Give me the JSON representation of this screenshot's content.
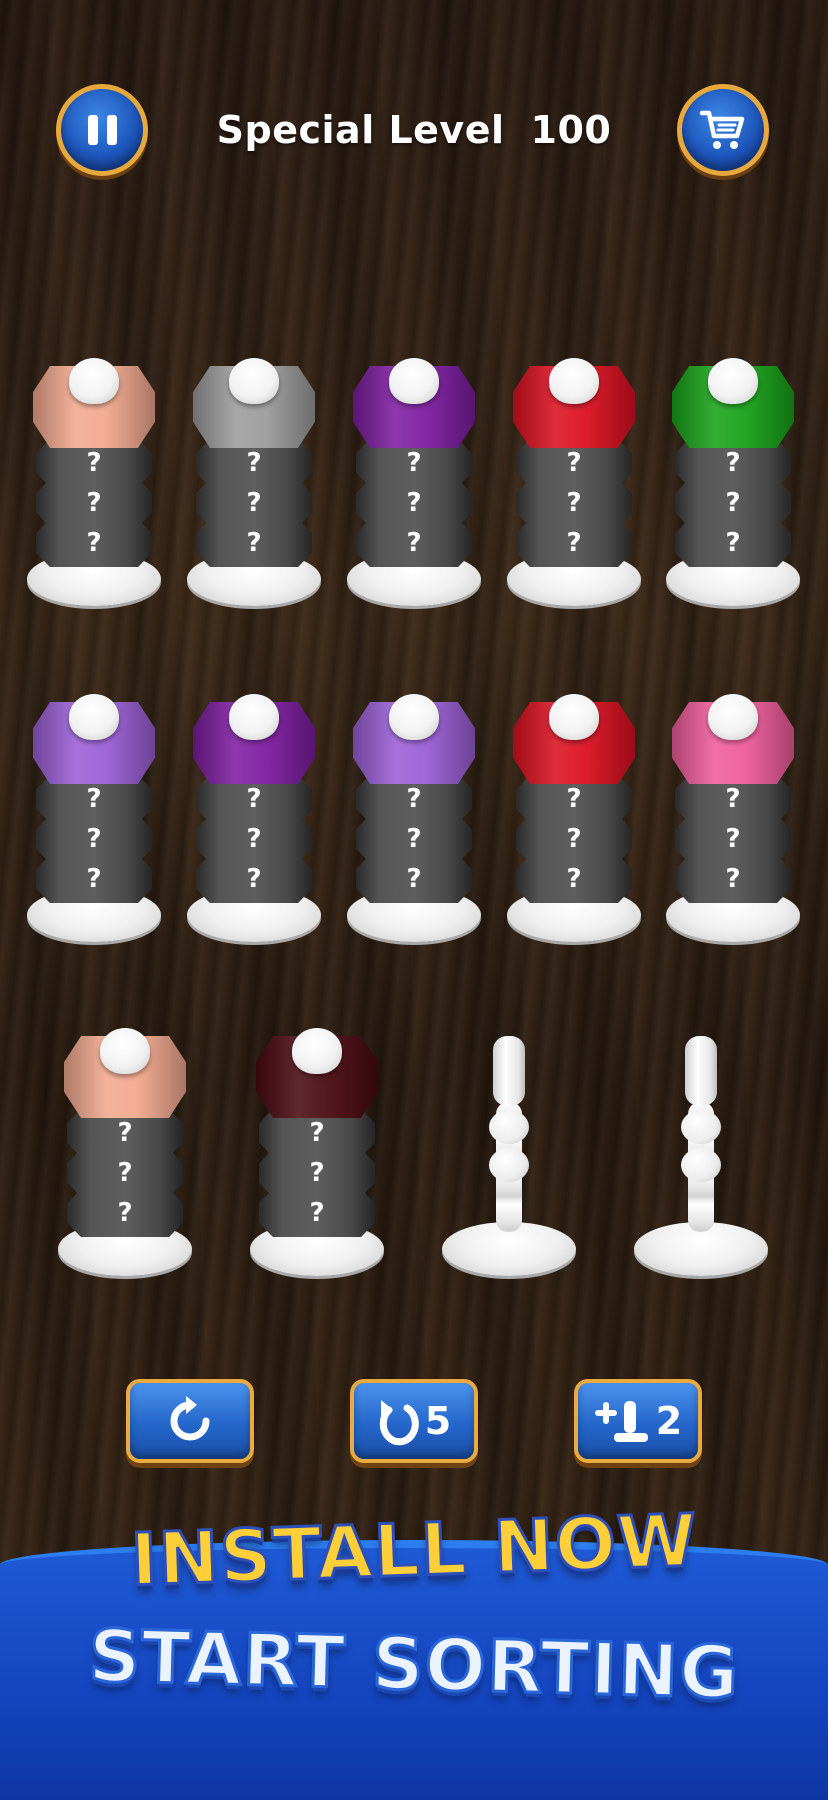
{
  "header": {
    "level_label": "Special Level",
    "level_number": "100",
    "pause_icon": "pause-icon",
    "cart_icon": "shopping-cart-icon"
  },
  "stacks": [
    {
      "top_color": "#f2a98e",
      "hidden": [
        "?",
        "?",
        "?"
      ]
    },
    {
      "top_color": "#9c9c9c",
      "hidden": [
        "?",
        "?",
        "?"
      ]
    },
    {
      "top_color": "#7d1da0",
      "hidden": [
        "?",
        "?",
        "?"
      ]
    },
    {
      "top_color": "#dc1020",
      "hidden": [
        "?",
        "?",
        "?"
      ]
    },
    {
      "top_color": "#18a218",
      "hidden": [
        "?",
        "?",
        "?"
      ]
    },
    {
      "top_color": "#9a5fd6",
      "hidden": [
        "?",
        "?",
        "?"
      ]
    },
    {
      "top_color": "#7d1da0",
      "hidden": [
        "?",
        "?",
        "?"
      ]
    },
    {
      "top_color": "#9a5fd6",
      "hidden": [
        "?",
        "?",
        "?"
      ]
    },
    {
      "top_color": "#dc1020",
      "hidden": [
        "?",
        "?",
        "?"
      ]
    },
    {
      "top_color": "#ef5c9a",
      "hidden": [
        "?",
        "?",
        "?"
      ]
    },
    {
      "top_color": "#f2a98e",
      "hidden": [
        "?",
        "?",
        "?"
      ]
    },
    {
      "top_color": "#4a0a12",
      "hidden": [
        "?",
        "?",
        "?"
      ]
    }
  ],
  "empty_poles": 2,
  "tools": {
    "reset_icon": "reset-icon",
    "undo_icon": "undo-icon",
    "undo_count": "5",
    "add_pole_icon": "add-pole-icon",
    "add_pole_count": "2"
  },
  "banner": {
    "line1": "INSTALL NOW",
    "line2": "START SORTING"
  }
}
